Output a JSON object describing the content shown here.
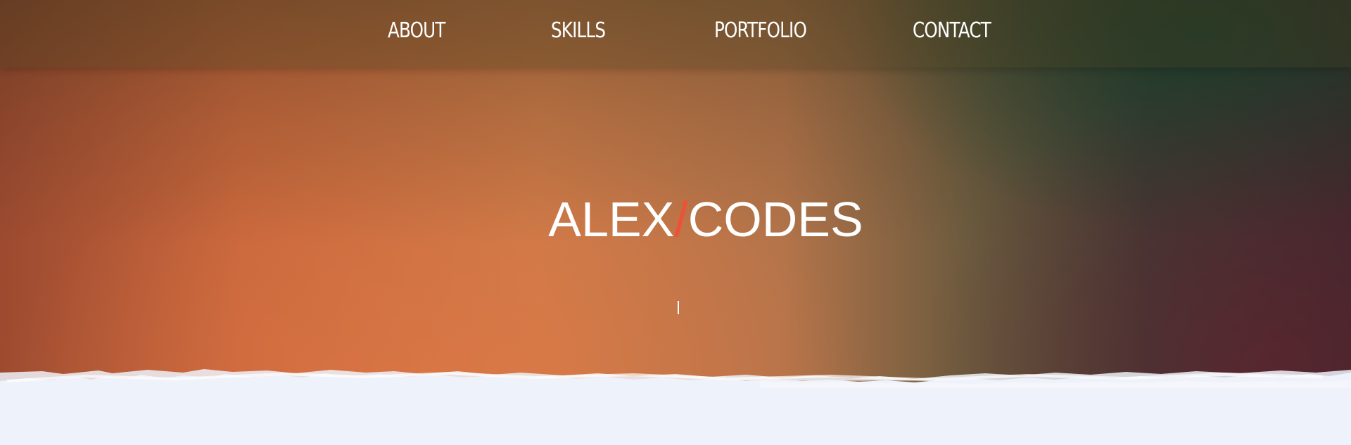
{
  "nav": {
    "items": [
      {
        "label": "ABOUT"
      },
      {
        "label": "SKILLS"
      },
      {
        "label": "PORTFOLIO"
      },
      {
        "label": "CONTACT"
      }
    ]
  },
  "hero": {
    "brand_first": "ALEX",
    "brand_slash": "/",
    "brand_second": "CODES",
    "typed_text": ""
  },
  "colors": {
    "accent": "#f0503a",
    "page_background": "#eef2fa",
    "text": "#ffffff"
  }
}
